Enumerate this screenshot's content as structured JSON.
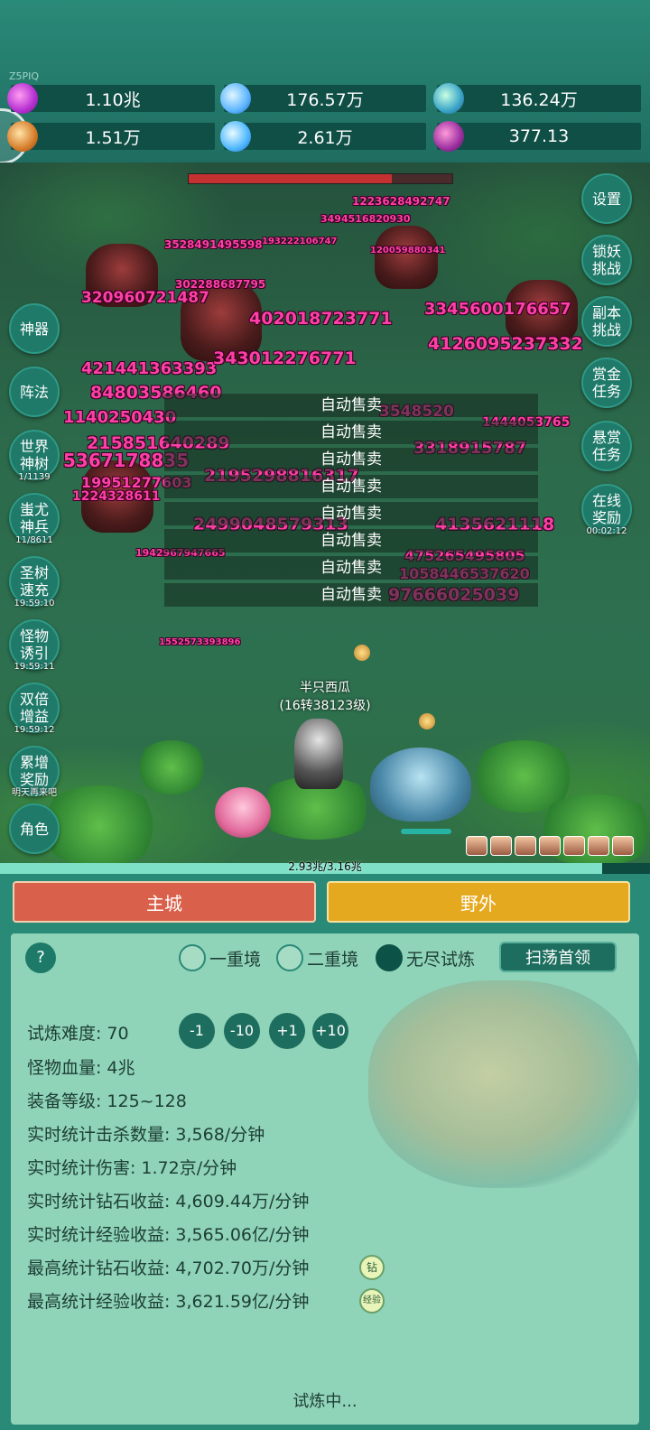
{
  "top_tag": "Z5PIQ",
  "resources": [
    {
      "icon": "purple-gem-icon",
      "value": "1.10兆"
    },
    {
      "icon": "blue-crystal-icon",
      "value": "176.57万"
    },
    {
      "icon": "elemental-orb-icon",
      "value": "136.24万"
    },
    {
      "icon": "golden-fish-icon",
      "value": "1.51万"
    },
    {
      "icon": "ice-shard-icon",
      "value": "2.61万"
    },
    {
      "icon": "purple-pot-icon",
      "value": "377.13"
    }
  ],
  "left_menu": [
    {
      "label": "神器",
      "sub": ""
    },
    {
      "label": "阵法",
      "sub": ""
    },
    {
      "label": "世界\n神树",
      "sub": "1/1139"
    },
    {
      "label": "蚩尤\n神兵",
      "sub": "11/8611"
    },
    {
      "label": "圣树\n速充",
      "sub": "19:59:10"
    },
    {
      "label": "怪物\n诱引",
      "sub": "19:59:11"
    },
    {
      "label": "双倍\n增益",
      "sub": "19:59:12"
    },
    {
      "label": "累增\n奖励",
      "sub": "明天再来吧"
    },
    {
      "label": "角色",
      "sub": ""
    }
  ],
  "right_menu": [
    {
      "label": "设置",
      "sub": ""
    },
    {
      "label": "锁妖\n挑战",
      "sub": ""
    },
    {
      "label": "副本\n挑战",
      "sub": ""
    },
    {
      "label": "赏金\n任务",
      "sub": ""
    },
    {
      "label": "悬赏\n任务",
      "sub": ""
    },
    {
      "label": "在线\n奖励",
      "sub": "00:02:12"
    }
  ],
  "auto_sell_label": "自动售卖",
  "damage_numbers": [
    "1223628492747",
    "3494516820930",
    "3528491495598",
    "193222106747",
    "120059880341",
    "320960721487",
    "302288687795",
    "3345600176657",
    "402018723771",
    "4126095237332",
    "421441363393",
    "343012276771",
    "84803586460",
    "1140250430",
    "3548520",
    "3318915787",
    "215851640289",
    "1444053765",
    "5367178835",
    "19951277603",
    "1224328611",
    "2195298816317",
    "2499048579313",
    "4135621118",
    "475265495805",
    "1058446537620",
    "97666025039",
    "1942967947665",
    "1552573393896"
  ],
  "player": {
    "name": "半只西瓜",
    "level": "(16转38123级)"
  },
  "boss_hp_fraction": 0.77,
  "exp_bar": {
    "text": "2.93兆/3.16兆",
    "fraction": 0.927
  },
  "tabs": {
    "city": "主城",
    "wild": "野外"
  },
  "modes": [
    {
      "label": "一重境",
      "selected": false
    },
    {
      "label": "二重境",
      "selected": false
    },
    {
      "label": "无尽试炼",
      "selected": true
    }
  ],
  "help_label": "?",
  "sweep_button": "扫荡首领",
  "difficulty": {
    "label": "试炼难度:",
    "value": "70",
    "buttons": [
      "-1",
      "-10",
      "+1",
      "+10"
    ]
  },
  "stats": [
    {
      "label": "怪物血量:",
      "value": "4兆"
    },
    {
      "label": "装备等级:",
      "value": "125~128"
    },
    {
      "label": "实时统计击杀数量:",
      "value": "3,568/分钟"
    },
    {
      "label": "实时统计伤害:",
      "value": "1.72京/分钟"
    },
    {
      "label": "实时统计钻石收益:",
      "value": "4,609.44万/分钟"
    },
    {
      "label": "实时统计经验收益:",
      "value": "3,565.06亿/分钟"
    },
    {
      "label": "最高统计钻石收益:",
      "value": "4,702.70万/分钟",
      "badge": "钻"
    },
    {
      "label": "最高统计经验收益:",
      "value": "3,621.59亿/分钟",
      "badge": "经验"
    }
  ],
  "status_text": "试炼中..."
}
